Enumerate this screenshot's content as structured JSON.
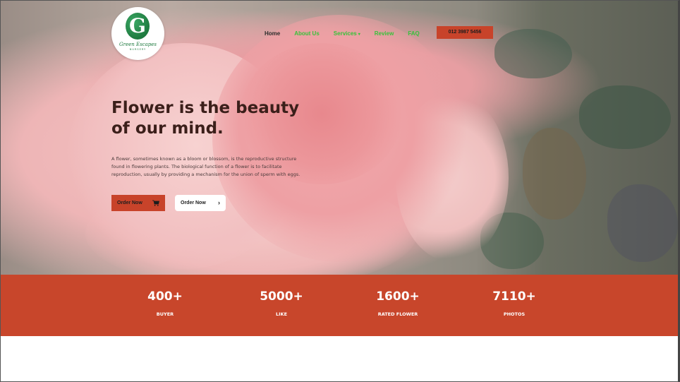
{
  "header": {
    "logo": {
      "letter": "G",
      "brand": "Green Escapes",
      "sub": "NURSERY"
    },
    "nav": [
      {
        "label": "Home"
      },
      {
        "label": "About Us"
      },
      {
        "label": "Services"
      },
      {
        "label": "Review"
      },
      {
        "label": "FAQ"
      }
    ],
    "phone": "012 3987 5456"
  },
  "hero": {
    "headline_line1": "Flower is the beauty",
    "headline_line2": "of our mind.",
    "description": "A flower, sometimes known as a bloom or blossom, is the reproductive structure found in flowering plants. The biological function of a flower is to facilitate reproduction, usually by providing a mechanism for the union of sperm with eggs.",
    "primary_button": "Order Now",
    "secondary_button": "Order Now"
  },
  "stats": [
    {
      "value": "400+",
      "label": "BUYER"
    },
    {
      "value": "5000+",
      "label": "LIKE"
    },
    {
      "value": "1600+",
      "label": "RATED FLOWER"
    },
    {
      "value": "7110+",
      "label": "PHOTOS"
    }
  ],
  "colors": {
    "accent": "#c8432a",
    "nav_green": "#38c23a",
    "logo_green": "#1e7a3f"
  }
}
